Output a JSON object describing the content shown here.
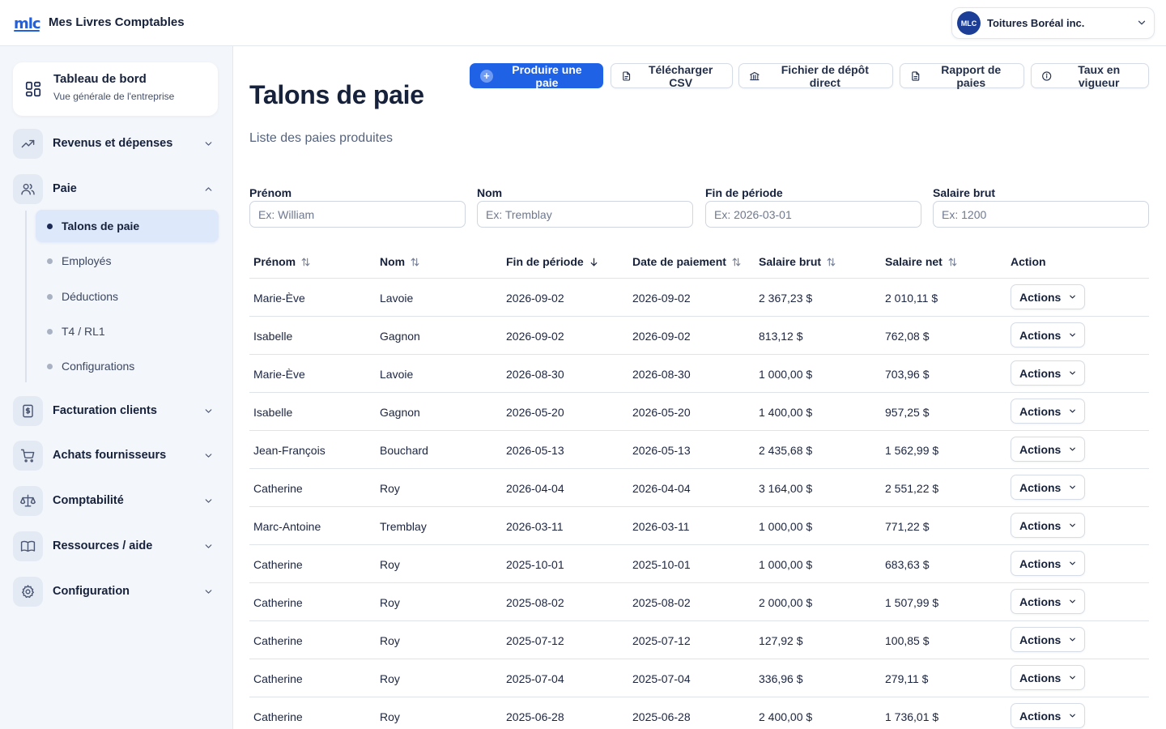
{
  "app": {
    "logo_text": "mlc",
    "title": "Mes Livres Comptables"
  },
  "company": {
    "initials": "MLC",
    "name": "Toitures Boréal inc."
  },
  "sidebar": {
    "dashboard": {
      "title": "Tableau de bord",
      "subtitle": "Vue générale de l'entreprise"
    },
    "groups": [
      {
        "label": "Revenus et dépenses",
        "icon": "trending-up-icon",
        "expanded": false
      },
      {
        "label": "Paie",
        "icon": "users-icon",
        "expanded": true
      },
      {
        "label": "Facturation clients",
        "icon": "invoice-dollar-icon",
        "expanded": false
      },
      {
        "label": "Achats fournisseurs",
        "icon": "cart-icon",
        "expanded": false
      },
      {
        "label": "Comptabilité",
        "icon": "scale-icon",
        "expanded": false
      },
      {
        "label": "Ressources / aide",
        "icon": "book-icon",
        "expanded": false
      },
      {
        "label": "Configuration",
        "icon": "gear-icon",
        "expanded": false
      }
    ],
    "paie_items": [
      {
        "label": "Talons de paie",
        "active": true
      },
      {
        "label": "Employés",
        "active": false
      },
      {
        "label": "Déductions",
        "active": false
      },
      {
        "label": "T4 / RL1",
        "active": false
      },
      {
        "label": "Configurations",
        "active": false
      }
    ]
  },
  "page": {
    "title": "Talons de paie",
    "subtitle": "Liste des paies produites",
    "buttons": {
      "produce": "Produire une paie",
      "csv": "Télécharger CSV",
      "deposit": "Fichier de dépôt direct",
      "report": "Rapport de paies",
      "rates": "Taux en vigueur"
    },
    "filters": [
      {
        "label": "Prénom",
        "placeholder": "Ex: William"
      },
      {
        "label": "Nom",
        "placeholder": "Ex: Tremblay"
      },
      {
        "label": "Fin de période",
        "placeholder": "Ex: 2026-03-01"
      },
      {
        "label": "Salaire brut",
        "placeholder": "Ex: 1200"
      }
    ]
  },
  "table": {
    "headers": {
      "prenom": "Prénom",
      "nom": "Nom",
      "fin": "Fin de période",
      "date": "Date de paiement",
      "brut": "Salaire brut",
      "net": "Salaire net",
      "action": "Action"
    },
    "sorted_column": "fin",
    "sort_direction": "desc",
    "actions_label": "Actions",
    "rows": [
      {
        "prenom": "Marie-Ève",
        "nom": "Lavoie",
        "fin": "2026-09-02",
        "date": "2026-09-02",
        "brut": "2 367,23 $",
        "net": "2 010,11 $"
      },
      {
        "prenom": "Isabelle",
        "nom": "Gagnon",
        "fin": "2026-09-02",
        "date": "2026-09-02",
        "brut": "813,12 $",
        "net": "762,08 $"
      },
      {
        "prenom": "Marie-Ève",
        "nom": "Lavoie",
        "fin": "2026-08-30",
        "date": "2026-08-30",
        "brut": "1 000,00 $",
        "net": "703,96 $"
      },
      {
        "prenom": "Isabelle",
        "nom": "Gagnon",
        "fin": "2026-05-20",
        "date": "2026-05-20",
        "brut": "1 400,00 $",
        "net": "957,25 $"
      },
      {
        "prenom": "Jean-François",
        "nom": "Bouchard",
        "fin": "2026-05-13",
        "date": "2026-05-13",
        "brut": "2 435,68 $",
        "net": "1 562,99 $"
      },
      {
        "prenom": "Catherine",
        "nom": "Roy",
        "fin": "2026-04-04",
        "date": "2026-04-04",
        "brut": "3 164,00 $",
        "net": "2 551,22 $"
      },
      {
        "prenom": "Marc-Antoine",
        "nom": "Tremblay",
        "fin": "2026-03-11",
        "date": "2026-03-11",
        "brut": "1 000,00 $",
        "net": "771,22 $"
      },
      {
        "prenom": "Catherine",
        "nom": "Roy",
        "fin": "2025-10-01",
        "date": "2025-10-01",
        "brut": "1 000,00 $",
        "net": "683,63 $"
      },
      {
        "prenom": "Catherine",
        "nom": "Roy",
        "fin": "2025-08-02",
        "date": "2025-08-02",
        "brut": "2 000,00 $",
        "net": "1 507,99 $"
      },
      {
        "prenom": "Catherine",
        "nom": "Roy",
        "fin": "2025-07-12",
        "date": "2025-07-12",
        "brut": "127,92 $",
        "net": "100,85 $"
      },
      {
        "prenom": "Catherine",
        "nom": "Roy",
        "fin": "2025-07-04",
        "date": "2025-07-04",
        "brut": "336,96 $",
        "net": "279,11 $"
      },
      {
        "prenom": "Catherine",
        "nom": "Roy",
        "fin": "2025-06-28",
        "date": "2025-06-28",
        "brut": "2 400,00 $",
        "net": "1 736,01 $"
      }
    ]
  },
  "colors": {
    "accent": "#1f62e6",
    "brand": "#1d3e96",
    "sidebar_bg": "#f3f6fa",
    "active_item_bg": "#dde8fa"
  }
}
